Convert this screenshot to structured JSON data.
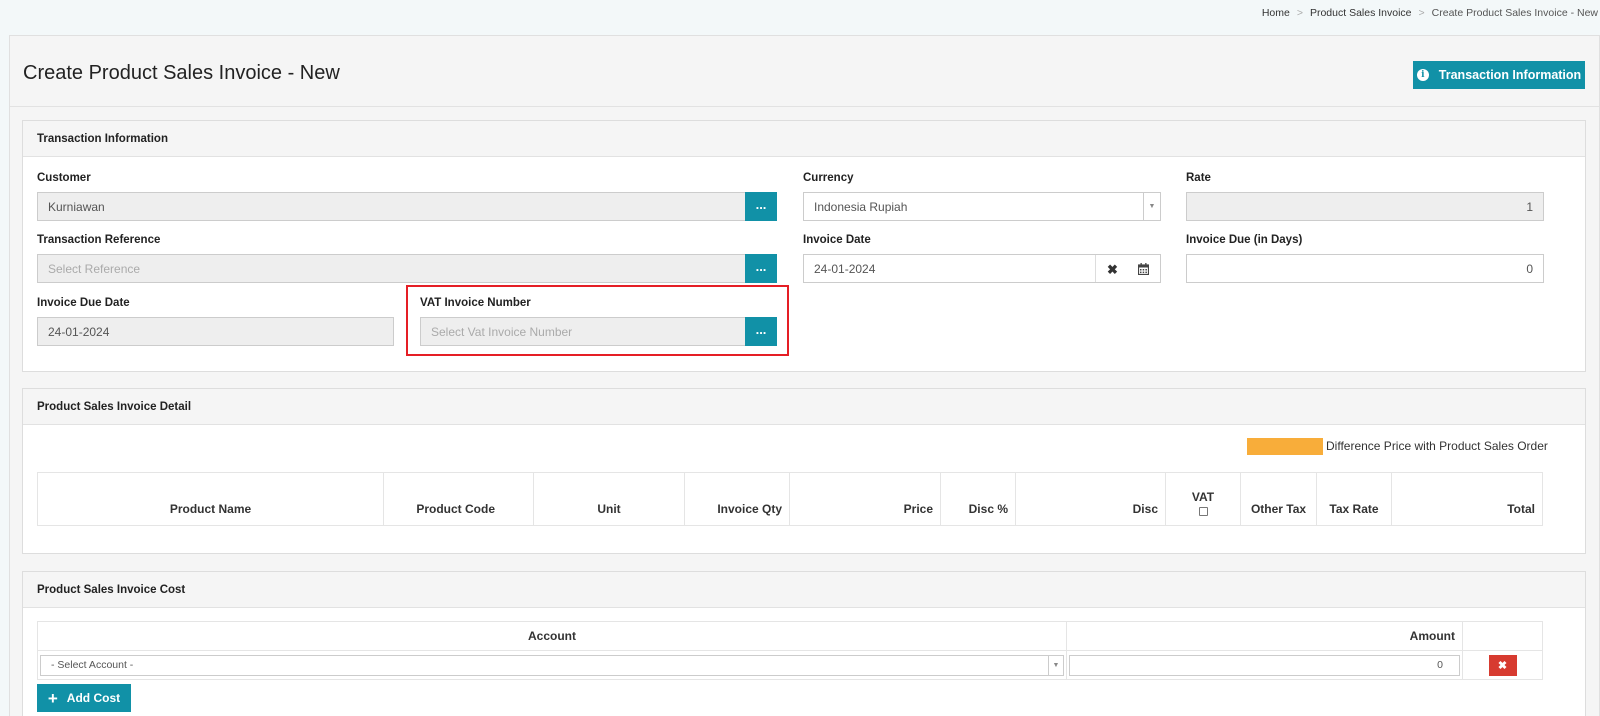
{
  "breadcrumb": {
    "home": "Home",
    "section": "Product Sales Invoice",
    "current": "Create Product Sales Invoice - New"
  },
  "page_title": "Create Product Sales Invoice - New",
  "header_button": {
    "label": "Transaction Information",
    "icon": "info-icon"
  },
  "transaction_panel": {
    "title": "Transaction Information",
    "customer": {
      "label": "Customer",
      "value": "Kurniawan",
      "button": "..."
    },
    "currency": {
      "label": "Currency",
      "value": "Indonesia Rupiah"
    },
    "rate": {
      "label": "Rate",
      "value": "1"
    },
    "reference": {
      "label": "Transaction Reference",
      "placeholder": "Select Reference",
      "button": "..."
    },
    "invoice_date": {
      "label": "Invoice Date",
      "value": "24-01-2024",
      "clear_icon": "✖",
      "calendar_icon": "calendar-icon"
    },
    "invoice_due_days": {
      "label": "Invoice Due (in Days)",
      "value": "0"
    },
    "invoice_due_date": {
      "label": "Invoice Due Date",
      "value": "24-01-2024"
    },
    "vat_invoice_number": {
      "label": "VAT Invoice Number",
      "placeholder": "Select Vat Invoice Number",
      "button": "..."
    }
  },
  "detail_panel": {
    "title": "Product Sales Invoice Detail",
    "legend": {
      "text": "Difference Price with Product Sales Order",
      "color": "#f8ad3a"
    },
    "columns": [
      "Product Name",
      "Product Code",
      "Unit",
      "Invoice Qty",
      "Price",
      "Disc %",
      "Disc",
      "VAT",
      "Other Tax",
      "Tax Rate",
      "Total"
    ]
  },
  "cost_panel": {
    "title": "Product Sales Invoice Cost",
    "columns": {
      "account": "Account",
      "amount": "Amount"
    },
    "row": {
      "account_placeholder": "- Select Account -",
      "amount": "0",
      "delete_icon": "✖"
    },
    "add_button": {
      "label": "Add Cost",
      "icon": "+"
    }
  },
  "colors": {
    "accent": "#1191a7",
    "highlight": "#e51e25",
    "danger": "#d73b30"
  }
}
